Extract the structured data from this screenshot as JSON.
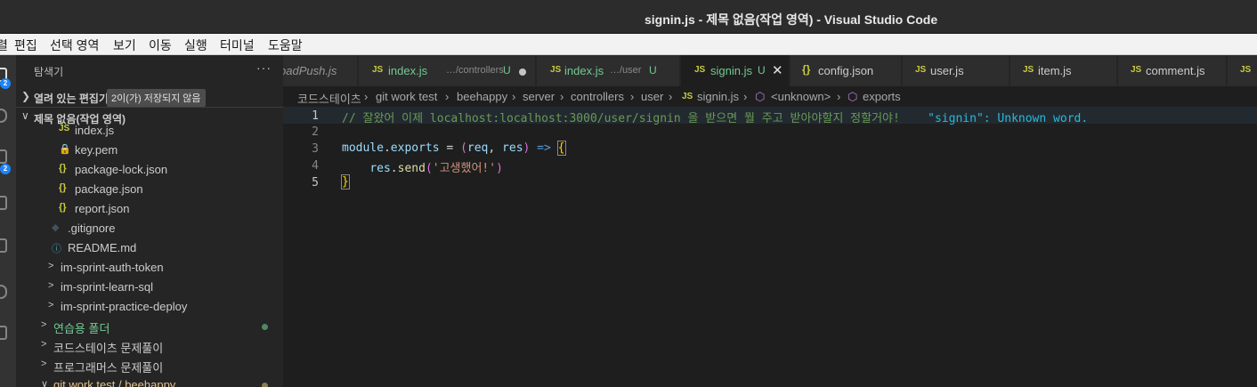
{
  "window": {
    "title": "signin.js - 제목 없음(작업 영역) - Visual Studio Code"
  },
  "menu": [
    "렬",
    "편집",
    "선택 영역",
    "보기",
    "이동",
    "실행",
    "터미널",
    "도움말"
  ],
  "activity": {
    "badges": [
      "2",
      "2"
    ],
    "icons": [
      "explorer-icon",
      "search-icon",
      "source-control-icon",
      "run-debug-icon",
      "extensions-icon",
      "remote-icon",
      "testing-icon"
    ]
  },
  "sidebar": {
    "header": "탐색기",
    "more": "···",
    "open_editors": {
      "label": "열려 있는 편집기",
      "badge": "2이(가) 저장되지 않음"
    },
    "workspace": {
      "label": "제목 없음(작업 영역)"
    },
    "items": [
      {
        "icon": "JS",
        "label": "index.js"
      },
      {
        "icon": "🔒",
        "label": "key.pem"
      },
      {
        "icon": "{}",
        "label": "package-lock.json"
      },
      {
        "icon": "{}",
        "label": "package.json"
      },
      {
        "icon": "{}",
        "label": "report.json"
      },
      {
        "icon": "◆",
        "label": ".gitignore"
      },
      {
        "icon": "ⓘ",
        "label": "README.md"
      },
      {
        "icon": ">",
        "label": "im-sprint-auth-token"
      },
      {
        "icon": ">",
        "label": "im-sprint-learn-sql"
      },
      {
        "icon": ">",
        "label": "im-sprint-practice-deploy"
      },
      {
        "icon": ">",
        "label": "연습용 폴더"
      },
      {
        "icon": ">",
        "label": "코드스테이츠 문제풀이"
      },
      {
        "icon": ">",
        "label": "프로그래머스 문제풀이"
      },
      {
        "icon": "∨",
        "label": "git work test / beehappy"
      }
    ],
    "dot_colors": {
      "green": "#4b8b62",
      "olive": "#8a7a55"
    }
  },
  "tabs": [
    {
      "icon": "",
      "label": "oadPush.js",
      "path": "",
      "status": ""
    },
    {
      "icon": "JS",
      "label": "index.js",
      "path": "…/controllers",
      "status": "U"
    },
    {
      "icon": "JS",
      "label": "index.js",
      "path": "…/user",
      "status": "U"
    },
    {
      "icon": "JS",
      "label": "signin.js",
      "path": "",
      "status": "U",
      "close": "✕"
    },
    {
      "icon": "{}",
      "label": "config.json",
      "path": "",
      "status": ""
    },
    {
      "icon": "JS",
      "label": "user.js",
      "path": "",
      "status": ""
    },
    {
      "icon": "JS",
      "label": "item.js",
      "path": "",
      "status": ""
    },
    {
      "icon": "JS",
      "label": "comment.js",
      "path": "",
      "status": ""
    },
    {
      "icon": "JS",
      "label": "",
      "path": "",
      "status": ""
    }
  ],
  "breadcrumb": [
    "코드스테이츠",
    "git work test",
    "beehappy",
    "server",
    "controllers",
    "user",
    "signin.js",
    "<unknown>",
    "exports"
  ],
  "editor": {
    "line_numbers": [
      "1",
      "2",
      "3",
      "4",
      "5"
    ],
    "line1_comment": "// 잘왔어 이제 localhost:localhost:3000/user/signin 을 받으면 뭘 주고 받아야할지 정할거야!",
    "line1_diag": "\"signin\": Unknown word.",
    "line3": {
      "module": "module",
      "dot1": ".",
      "exports": "exports",
      "eq": " = ",
      "lpar": "(",
      "req": "req",
      "comma": ", ",
      "res": "res",
      "rpar": ")",
      "arrow": " => ",
      "brace": "{"
    },
    "line4": {
      "indent": "    ",
      "res": "res",
      "dot": ".",
      "send": "send",
      "lpar": "(",
      "str": "'고생했어!'",
      "rpar": ")"
    },
    "line5": {
      "brace": "}"
    }
  }
}
